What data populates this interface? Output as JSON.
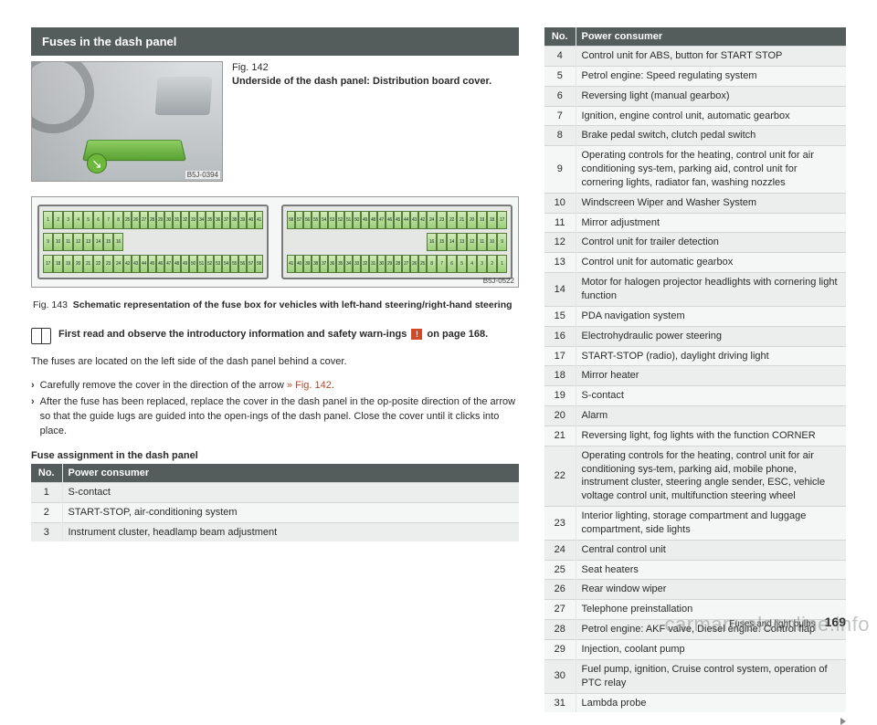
{
  "section_title": "Fuses in the dash panel",
  "fig142": {
    "num": "Fig. 142",
    "title": "Underside of the dash panel: Distribution board cover.",
    "photo_id": "B5J-0394"
  },
  "diagram": {
    "photo_id": "B5J-0522",
    "left": {
      "top_a": [
        "1",
        "2",
        "3",
        "4",
        "5",
        "6",
        "7",
        "8"
      ],
      "top_b": [
        "25",
        "26",
        "27",
        "28",
        "29",
        "30",
        "31",
        "32",
        "33",
        "34",
        "35",
        "36",
        "37",
        "38",
        "39",
        "40",
        "41"
      ],
      "mid": [
        "9",
        "10",
        "11",
        "12",
        "13",
        "14",
        "15",
        "16"
      ],
      "bot_a": [
        "17",
        "18",
        "19",
        "20",
        "21",
        "22",
        "23",
        "24"
      ],
      "bot_b": [
        "42",
        "43",
        "44",
        "45",
        "46",
        "47",
        "48",
        "49",
        "50",
        "51",
        "52",
        "53",
        "54",
        "55",
        "56",
        "57",
        "58"
      ]
    },
    "right": {
      "top_a": [
        "58",
        "57",
        "56",
        "55",
        "54",
        "53",
        "52",
        "51",
        "50",
        "49",
        "48",
        "47",
        "46",
        "45",
        "44",
        "43",
        "42"
      ],
      "top_b": [
        "24",
        "23",
        "22",
        "21",
        "20",
        "19",
        "18",
        "17"
      ],
      "mid": [
        "16",
        "15",
        "14",
        "13",
        "12",
        "11",
        "10",
        "9"
      ],
      "bot_a": [
        "41",
        "40",
        "39",
        "38",
        "37",
        "36",
        "35",
        "34",
        "33",
        "32",
        "31",
        "30",
        "29",
        "28",
        "27",
        "26",
        "25"
      ],
      "bot_b": [
        "8",
        "7",
        "6",
        "5",
        "4",
        "3",
        "2",
        "1"
      ]
    }
  },
  "fig143": {
    "label": "Fig. 143",
    "text": "Schematic representation of the fuse box for vehicles with left-hand steering/right-hand steering"
  },
  "read_first": {
    "pre": "First read and observe the introductory information and safety warn-ings",
    "warn": "!",
    "post": "on page 168."
  },
  "body1": "The fuses are located on the left side of the dash panel behind a cover.",
  "steps": [
    {
      "chev": "›",
      "text_pre": "Carefully remove the cover in the direction of the arrow ",
      "ref": "» Fig. 142",
      "text_post": "."
    },
    {
      "chev": "›",
      "text_pre": "After the fuse has been replaced, replace the cover in the dash panel in the op-posite direction of the arrow so that the guide lugs are guided into the open-ings of the dash panel. Close the cover until it clicks into place.",
      "ref": "",
      "text_post": ""
    }
  ],
  "table_heading": "Fuse assignment in the dash panel",
  "table_headers": {
    "no": "No.",
    "consumer": "Power consumer"
  },
  "left_rows": [
    {
      "no": "1",
      "consumer": "S-contact"
    },
    {
      "no": "2",
      "consumer": "START-STOP, air-conditioning system"
    },
    {
      "no": "3",
      "consumer": "Instrument cluster, headlamp beam adjustment"
    }
  ],
  "right_rows": [
    {
      "no": "4",
      "consumer": "Control unit for ABS, button for START STOP"
    },
    {
      "no": "5",
      "consumer": "Petrol engine: Speed regulating system"
    },
    {
      "no": "6",
      "consumer": "Reversing light (manual gearbox)"
    },
    {
      "no": "7",
      "consumer": "Ignition, engine control unit, automatic gearbox"
    },
    {
      "no": "8",
      "consumer": "Brake pedal switch, clutch pedal switch"
    },
    {
      "no": "9",
      "consumer": "Operating controls for the heating, control unit for air conditioning sys-tem, parking aid, control unit for cornering lights, radiator fan, washing nozzles"
    },
    {
      "no": "10",
      "consumer": "Windscreen Wiper and Washer System"
    },
    {
      "no": "11",
      "consumer": "Mirror adjustment"
    },
    {
      "no": "12",
      "consumer": "Control unit for trailer detection"
    },
    {
      "no": "13",
      "consumer": "Control unit for automatic gearbox"
    },
    {
      "no": "14",
      "consumer": "Motor for halogen projector headlights with cornering light function"
    },
    {
      "no": "15",
      "consumer": "PDA navigation system"
    },
    {
      "no": "16",
      "consumer": "Electrohydraulic power steering"
    },
    {
      "no": "17",
      "consumer": "START-STOP (radio), daylight driving light"
    },
    {
      "no": "18",
      "consumer": "Mirror heater"
    },
    {
      "no": "19",
      "consumer": "S-contact"
    },
    {
      "no": "20",
      "consumer": "Alarm"
    },
    {
      "no": "21",
      "consumer": "Reversing light, fog lights with the function CORNER"
    },
    {
      "no": "22",
      "consumer": "Operating controls for the heating, control unit for air conditioning sys-tem, parking aid, mobile phone, instrument cluster, steering angle sender, ESC, vehicle voltage control unit, multifunction steering wheel"
    },
    {
      "no": "23",
      "consumer": "Interior lighting, storage compartment and luggage compartment, side lights"
    },
    {
      "no": "24",
      "consumer": "Central control unit"
    },
    {
      "no": "25",
      "consumer": "Seat heaters"
    },
    {
      "no": "26",
      "consumer": "Rear window wiper"
    },
    {
      "no": "27",
      "consumer": "Telephone preinstallation"
    },
    {
      "no": "28",
      "consumer": "Petrol engine: AKF valve, Diesel engine: Control flap"
    },
    {
      "no": "29",
      "consumer": "Injection, coolant pump"
    },
    {
      "no": "30",
      "consumer": "Fuel pump, ignition, Cruise control system, operation of PTC relay"
    },
    {
      "no": "31",
      "consumer": "Lambda probe"
    }
  ],
  "footer": {
    "text": "Fuses and light bulbs",
    "page": "169"
  },
  "watermark": "carmanualsonline.info"
}
